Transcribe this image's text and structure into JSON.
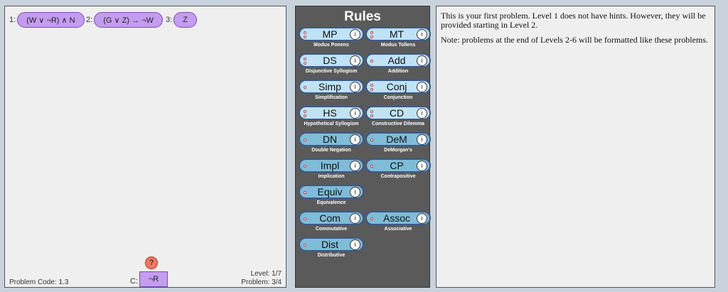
{
  "workspace": {
    "premises": [
      {
        "num": "1:",
        "formula": "(W ∨ ¬R) ∧ N"
      },
      {
        "num": "2:",
        "formula": "(G ∨ Z) → ¬W"
      },
      {
        "num": "3:",
        "formula": "Z"
      }
    ],
    "help_symbol": "?",
    "conclusion_label": "C:",
    "conclusion": "¬R",
    "problem_code": "Problem Code: 1.3",
    "level": "Level: 1/7",
    "problem": "Problem: 3/4"
  },
  "rules": {
    "title": "Rules",
    "info_symbol": "i",
    "items": [
      {
        "abbr": "MP",
        "name": "Modus Ponens",
        "dots": 2
      },
      {
        "abbr": "MT",
        "name": "Modus Tollens",
        "dots": 2
      },
      {
        "abbr": "DS",
        "name": "Disjunctive Syllogism",
        "dots": 2
      },
      {
        "abbr": "Add",
        "name": "Addition",
        "dots": 1
      },
      {
        "abbr": "Simp",
        "name": "Simplification",
        "dots": 1
      },
      {
        "abbr": "Conj",
        "name": "Conjunction",
        "dots": 2
      },
      {
        "abbr": "HS",
        "name": "Hypothetical Syllogism",
        "dots": 2
      },
      {
        "abbr": "CD",
        "name": "Constructive Dilemma",
        "dots": 2
      },
      {
        "abbr": "DN",
        "name": "Double Negation",
        "dots": 1
      },
      {
        "abbr": "DeM",
        "name": "DeMorgan's",
        "dots": 1
      },
      {
        "abbr": "Impl",
        "name": "Implication",
        "dots": 1
      },
      {
        "abbr": "CP",
        "name": "Contrapositive",
        "dots": 1
      },
      {
        "abbr": "Equiv",
        "name": "Equivalence",
        "dots": 1
      },
      {
        "abbr": "Com",
        "name": "Commutative",
        "dots": 1
      },
      {
        "abbr": "Assoc",
        "name": "Associative",
        "dots": 1
      },
      {
        "abbr": "Dist",
        "name": "Distributive",
        "dots": 1
      }
    ]
  },
  "info": {
    "para1": "This is your first problem. Level 1 does not have hints. However, they will be provided starting in Level 2.",
    "para2": "Note: problems at the end of Levels 2-6 will be formatted like these problems."
  }
}
